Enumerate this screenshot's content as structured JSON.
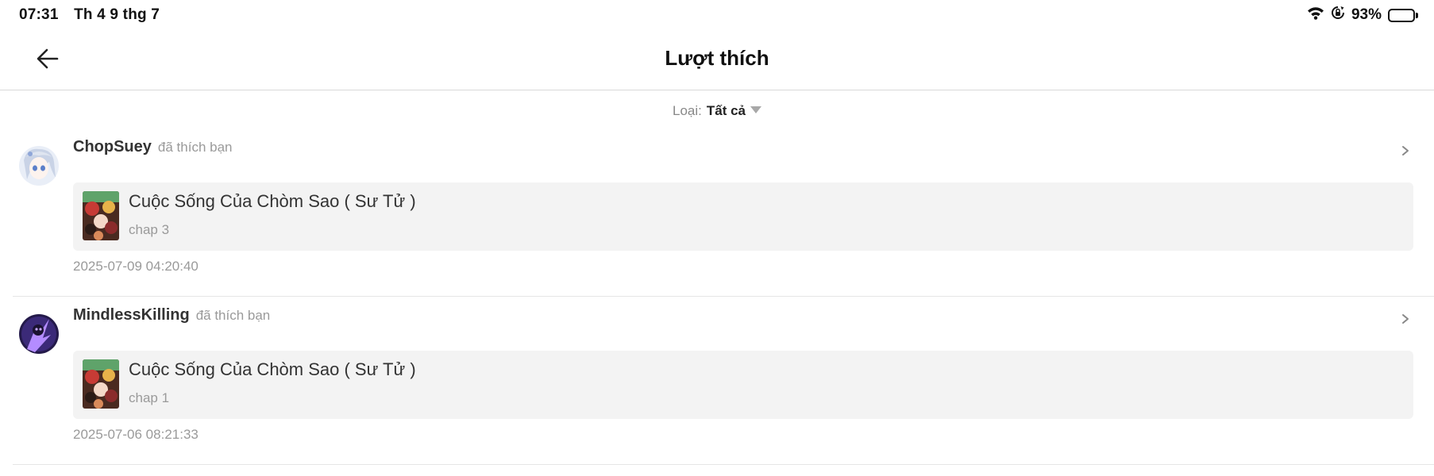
{
  "status_bar": {
    "time": "07:31",
    "date": "Th 4 9 thg 7",
    "battery_percent": "93%",
    "battery_level": 0.93,
    "icons": [
      "wifi-icon",
      "orientation-lock-icon",
      "battery-icon"
    ]
  },
  "header": {
    "title": "Lượt thích",
    "back_icon": "arrow-left-icon"
  },
  "filter": {
    "label": "Loại:",
    "value": "Tất cả"
  },
  "notifications": [
    {
      "user": "ChopSuey",
      "action": "đã thích bạn",
      "story_title": "Cuộc Sống Của Chòm Sao ( Sư Tử )",
      "chapter": "chap 3",
      "timestamp": "2025-07-09 04:20:40"
    },
    {
      "user": "MindlessKilling",
      "action": "đã thích bạn",
      "story_title": "Cuộc Sống Của Chòm Sao ( Sư Tử )",
      "chapter": "chap 1",
      "timestamp": "2025-07-06 08:21:33"
    }
  ]
}
